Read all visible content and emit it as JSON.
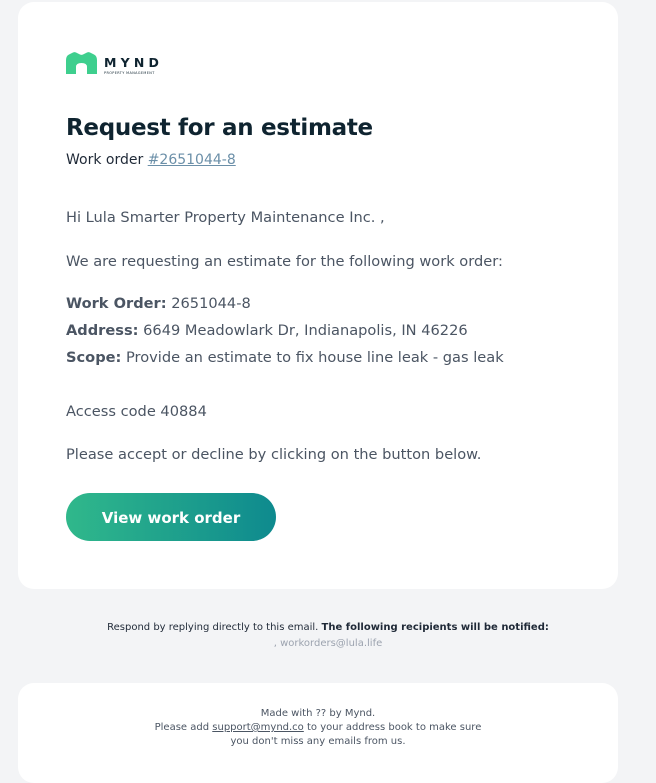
{
  "brand": {
    "name": "MYND",
    "tagline": "PROPERTY MANAGEMENT",
    "logo_color": "#3ecf8e",
    "icon": "house-logo-icon"
  },
  "header": {
    "title": "Request for an estimate",
    "work_order_label": "Work order",
    "work_order_link": "#2651044-8"
  },
  "body": {
    "greeting": "Hi Lula Smarter Property Maintenance Inc. ,",
    "intro": "We are requesting an estimate for the following work order:",
    "details": {
      "work_order_label": "Work Order:",
      "work_order_value": "2651044-8",
      "address_label": "Address:",
      "address_value": "6649 Meadowlark Dr, Indianapolis, IN 46226",
      "scope_label": "Scope:",
      "scope_value": "Provide an estimate to fix house line leak - gas leak"
    },
    "access_code": "Access code 40884",
    "instruction": "Please accept or decline by clicking on the button below.",
    "button_label": "View work order"
  },
  "notice": {
    "respond_text": "Respond by replying directly to this email.",
    "respond_bold": "The following recipients will be notified:",
    "recipients": ", workorders@lula.life"
  },
  "footer": {
    "made_with": "Made with ?? by Mynd.",
    "add_prefix": "Please add",
    "support_email": "support@mynd.co",
    "add_suffix": "to your address book to make sure",
    "line3": "you don't miss any emails from us."
  },
  "colors": {
    "background": "#f3f4f6",
    "card": "#ffffff",
    "title": "#0f2430",
    "button_start": "#30b88b",
    "button_end": "#0e8a8e",
    "link": "#6b8fa8"
  }
}
